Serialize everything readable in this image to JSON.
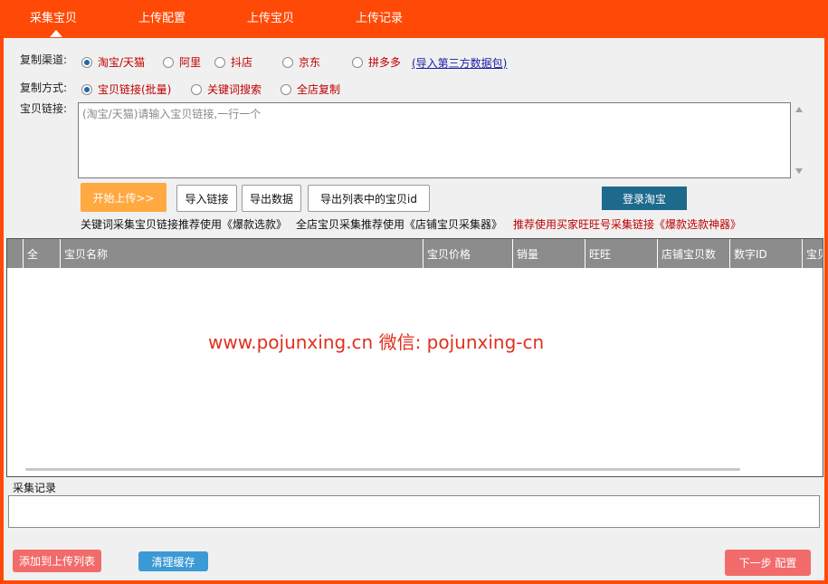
{
  "tabs": [
    {
      "label": "采集宝贝"
    },
    {
      "label": "上传配置"
    },
    {
      "label": "上传宝贝"
    },
    {
      "label": "上传记录"
    }
  ],
  "channel": {
    "label": "复制渠道:",
    "options": [
      "淘宝/天猫",
      "阿里",
      "抖店",
      "京东",
      "拼多多"
    ],
    "selected": "淘宝/天猫",
    "import_link": "(导入第三方数据包)"
  },
  "method": {
    "label": "复制方式:",
    "options": [
      "宝贝链接(批量)",
      "关键词搜索",
      "全店复制"
    ],
    "selected": "宝贝链接(批量)"
  },
  "links": {
    "label": "宝贝链接:",
    "placeholder": "(淘宝/天猫)请输入宝贝链接,一行一个"
  },
  "toolbar": {
    "start_upload": "开始上传>>",
    "import_links": "导入链接",
    "export_data": "导出数据",
    "export_ids": "导出列表中的宝贝id",
    "login_taobao": "登录淘宝"
  },
  "hints": [
    "关键词采集宝贝链接推荐使用《爆款选款》",
    "全店宝贝采集推荐使用《店铺宝贝采集器》",
    "推荐使用买家旺旺号采集链接《爆款选款神器》"
  ],
  "table": {
    "columns": [
      "",
      "全",
      "宝贝名称",
      "宝贝价格",
      "销量",
      "旺旺",
      "店铺宝贝数",
      "数字ID",
      "宝贝"
    ]
  },
  "watermark": "www.pojunxing.cn   微信: pojunxing-cn",
  "log": {
    "title": "采集记录"
  },
  "footer": {
    "add_to_upload": "添加到上传列表",
    "clear_cache": "清理缓存",
    "next_step": "下一步 配置"
  },
  "colors": {
    "brand": "#FF4A07",
    "start_button": "#FFA940",
    "login_button": "#1E6A8C",
    "clear_button": "#3B9AD6",
    "footer_pink": "#F26B6B"
  }
}
